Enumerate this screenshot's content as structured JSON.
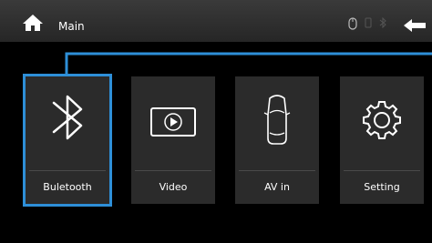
{
  "header": {
    "title": "Main",
    "home_icon": "home-icon",
    "back_icon": "back-arrow-icon"
  },
  "status_icons": [
    "mouse-icon",
    "phone-icon",
    "bluetooth-icon"
  ],
  "tiles": [
    {
      "label": "Buletooth",
      "icon": "bluetooth-icon",
      "selected": true
    },
    {
      "label": "Video",
      "icon": "play-icon",
      "selected": false
    },
    {
      "label": "AV in",
      "icon": "car-icon",
      "selected": false
    },
    {
      "label": "Setting",
      "icon": "gear-icon",
      "selected": false
    }
  ],
  "colors": {
    "accent": "#2e8fd8",
    "tile": "#2b2b2b",
    "topbar": "#2f2f2f"
  }
}
